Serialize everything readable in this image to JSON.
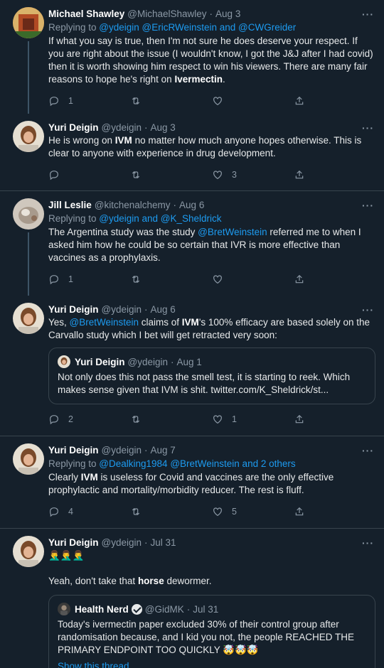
{
  "tweets": [
    {
      "name": "Michael Shawley",
      "handle": "@MichaelShawley",
      "date": "Aug 3",
      "reply_prefix": "Replying to ",
      "reply_links": "@ydeigin @EricRWeinstein and @CWGreider",
      "text_1": "If what you say is true, then I'm not sure he does deserve your respect. If you are right about the issue (I wouldn't know, I got the J&J after I had covid) then it is worth showing him respect to win his viewers. There are many fair reasons to hope he's right on ",
      "text_bold": "Ivermectin",
      "text_2": ".",
      "replies": "1",
      "retweets": "",
      "likes": ""
    },
    {
      "name": "Yuri Deigin",
      "handle": "@ydeigin",
      "date": "Aug 3",
      "text_1": "He is wrong on ",
      "text_bold": "IVM",
      "text_2": " no matter how much anyone hopes otherwise. This is clear to anyone with experience in drug development.",
      "replies": "",
      "retweets": "",
      "likes": "3"
    },
    {
      "name": "Jill Leslie",
      "handle": "@kitchenalchemy",
      "date": "Aug 6",
      "reply_prefix": "Replying to ",
      "reply_links": "@ydeigin and @K_Sheldrick",
      "text_1": "The Argentina study was the study ",
      "text_link": "@BretWeinstein",
      "text_2": " referred me to when I asked him how he could be so certain that IVR is more effective than vaccines as a prophylaxis.",
      "replies": "1",
      "retweets": "",
      "likes": ""
    },
    {
      "name": "Yuri Deigin",
      "handle": "@ydeigin",
      "date": "Aug 6",
      "text_1": "Yes, ",
      "text_link": "@BretWeinstein",
      "text_2": " claims of ",
      "text_bold": "IVM",
      "text_3": "'s 100% efficacy are based solely on the Carvallo study which I bet will get retracted very soon:",
      "quote": {
        "name": "Yuri Deigin",
        "handle": "@ydeigin",
        "date": "Aug 1",
        "text": "Not only does this not pass the smell test, it is starting to reek. Which makes sense given that IVM is shit. twitter.com/K_Sheldrick/st..."
      },
      "replies": "2",
      "retweets": "",
      "likes": "1"
    },
    {
      "name": "Yuri Deigin",
      "handle": "@ydeigin",
      "date": "Aug 7",
      "reply_prefix": "Replying to ",
      "reply_links": "@Dealking1984 @BretWeinstein and 2 others",
      "text_1": "Clearly ",
      "text_bold": "IVM",
      "text_2": " is useless for Covid and vaccines are the only effective prophylactic and mortality/morbidity reducer. The rest is fluff.",
      "replies": "4",
      "retweets": "",
      "likes": "5"
    },
    {
      "name": "Yuri Deigin",
      "handle": "@ydeigin",
      "date": "Jul 31",
      "emoji_line": "🤦‍♂️🤦‍♂️🤦‍♂️",
      "text_1": "Yeah, don't take that ",
      "text_bold": "horse",
      "text_2": " dewormer.",
      "quote": {
        "name": "Health Nerd",
        "handle": "@GidMK",
        "date": "Jul 31",
        "text": "Today's ivermectin paper excluded 30% of their control group after randomisation because, and I kid you not, the people REACHED THE PRIMARY ENDPOINT TOO QUICKLY 🤯🤯🤯",
        "show_thread": "Show this thread"
      }
    }
  ],
  "more_label": "···",
  "colors": {
    "background": "#15202b",
    "divider": "#38444d",
    "link": "#1d9bf0",
    "muted": "#8b98a5",
    "text": "#e7e9ea"
  }
}
